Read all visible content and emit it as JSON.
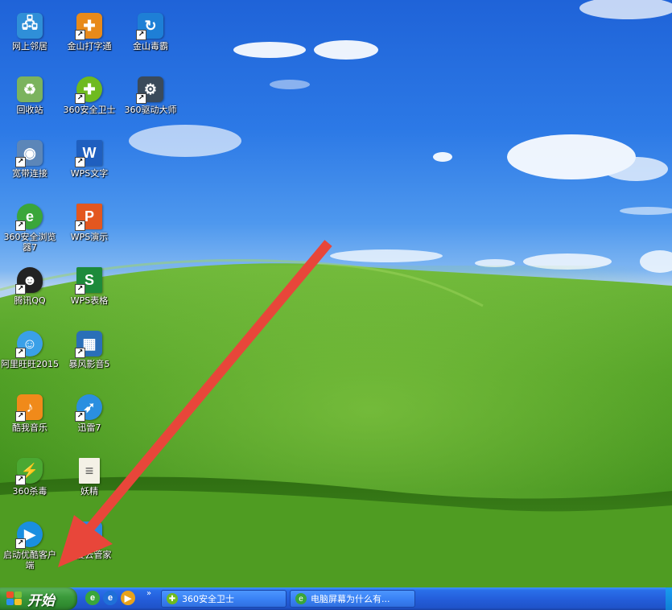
{
  "desktop": {
    "icons": [
      {
        "label": "网上邻居",
        "icon": "network-neighborhood-icon",
        "glyph": "🖧",
        "color": "#2f8fd8",
        "shortcut": false
      },
      {
        "label": "金山打字通",
        "icon": "jinshan-typing-icon",
        "glyph": "✚",
        "color": "#e88a1a",
        "shortcut": true
      },
      {
        "label": "金山毒霸",
        "icon": "jinshan-antivirus-icon",
        "glyph": "↻",
        "color": "#1e7fd6",
        "shortcut": true
      },
      {
        "label": "回收站",
        "icon": "recycle-bin-icon",
        "glyph": "♻",
        "color": "#6aa84f",
        "shortcut": false
      },
      {
        "label": "360安全卫士",
        "icon": "360-security-icon",
        "glyph": "✚",
        "color": "#6fba1f",
        "shortcut": true
      },
      {
        "label": "360驱动大师",
        "icon": "360-driver-master-icon",
        "glyph": "⚙",
        "color": "#3a4a5a",
        "shortcut": true
      },
      {
        "label": "宽带连接",
        "icon": "broadband-connection-icon",
        "glyph": "◉",
        "color": "#5c86b8",
        "shortcut": true
      },
      {
        "label": "WPS文字",
        "icon": "wps-writer-icon",
        "glyph": "W",
        "color": "#1f5fbf",
        "shortcut": true
      },
      {
        "label": "360安全浏览器7",
        "icon": "360-browser-icon",
        "glyph": "e",
        "color": "#3aa63a",
        "shortcut": true
      },
      {
        "label": "WPS演示",
        "icon": "wps-presentation-icon",
        "glyph": "P",
        "color": "#e3571f",
        "shortcut": true
      },
      {
        "label": "腾讯QQ",
        "icon": "qq-icon",
        "glyph": "☻",
        "color": "#222222",
        "shortcut": true
      },
      {
        "label": "WPS表格",
        "icon": "wps-spreadsheet-icon",
        "glyph": "S",
        "color": "#1d8a3a",
        "shortcut": true
      },
      {
        "label": "阿里旺旺2015",
        "icon": "aliwangwang-icon",
        "glyph": "☺",
        "color": "#3aa0e8",
        "shortcut": true
      },
      {
        "label": "暴风影音5",
        "icon": "baofeng-player-icon",
        "glyph": "▦",
        "color": "#2a6fb8",
        "shortcut": true
      },
      {
        "label": "酷我音乐",
        "icon": "kuwo-music-icon",
        "glyph": "♪",
        "color": "#f08a1a",
        "shortcut": true
      },
      {
        "label": "迅雷7",
        "icon": "xunlei-icon",
        "glyph": "➶",
        "color": "#2a8fe0",
        "shortcut": true
      },
      {
        "label": "360杀毒",
        "icon": "360-antivirus-icon",
        "glyph": "⚡",
        "color": "#4aa832",
        "shortcut": true
      },
      {
        "label": "妖精",
        "icon": "text-document-icon",
        "glyph": "≡",
        "color": "#d9d2b8",
        "shortcut": false
      },
      {
        "label": "启动优酷客户端",
        "icon": "youku-client-icon",
        "glyph": "▶",
        "color": "#1a8fe0",
        "shortcut": true
      },
      {
        "label": "百度云管家",
        "icon": "baidu-cloud-icon",
        "glyph": "☁",
        "color": "#2a88e0",
        "shortcut": true
      }
    ]
  },
  "taskbar": {
    "start_label": "开始",
    "quick_launch": [
      {
        "icon": "360-browser-quicklaunch-icon",
        "glyph": "e",
        "color": "#3aa63a"
      },
      {
        "icon": "ie-quicklaunch-icon",
        "glyph": "e",
        "color": "#1f6fd8"
      },
      {
        "icon": "media-player-quicklaunch-icon",
        "glyph": "▶",
        "color": "#e8a21a"
      }
    ],
    "quick_launch_more": "»",
    "tasks": [
      {
        "label": "360安全卫士",
        "icon": "360-security-task-icon",
        "glyph": "✚",
        "color": "#6fba1f"
      },
      {
        "label": "电脑屏幕为什么有...",
        "icon": "360-browser-task-icon",
        "glyph": "e",
        "color": "#3aa63a"
      }
    ]
  }
}
